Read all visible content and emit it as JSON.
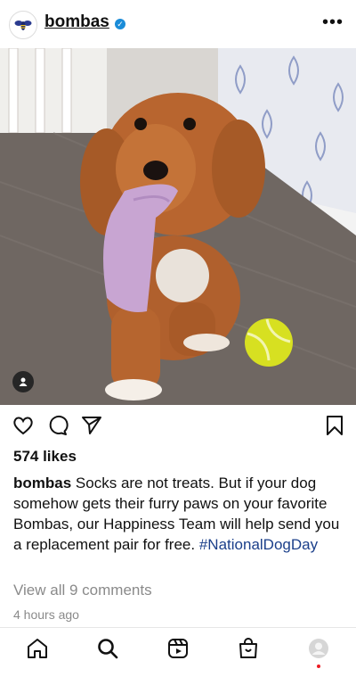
{
  "post": {
    "username": "bombas",
    "verified": true,
    "likes": "574 likes",
    "caption_user": "bombas",
    "caption_text": "Socks are not treats. But if your dog somehow gets their furry paws on your favorite Bombas, our Happiness Team will help send you a replacement pair for free.",
    "hashtag": "#NationalDogDay",
    "comments_link": "View all 9 comments",
    "timestamp": "4 hours ago"
  },
  "icons": {
    "header_avatar": "bee-logo-icon",
    "more": "more-options-icon",
    "tag": "user-tag-icon",
    "like": "heart-icon",
    "comment": "comment-icon",
    "share": "paper-plane-icon",
    "save": "bookmark-icon"
  },
  "tabbar": {
    "items": [
      "home-icon",
      "search-icon",
      "reels-icon",
      "shop-icon",
      "profile-icon"
    ],
    "notification_color": "#ed1c24"
  },
  "colors": {
    "verified": "#1a8cd8",
    "hashtag": "#1b3f8a",
    "muted_text": "#8a8a8a"
  }
}
